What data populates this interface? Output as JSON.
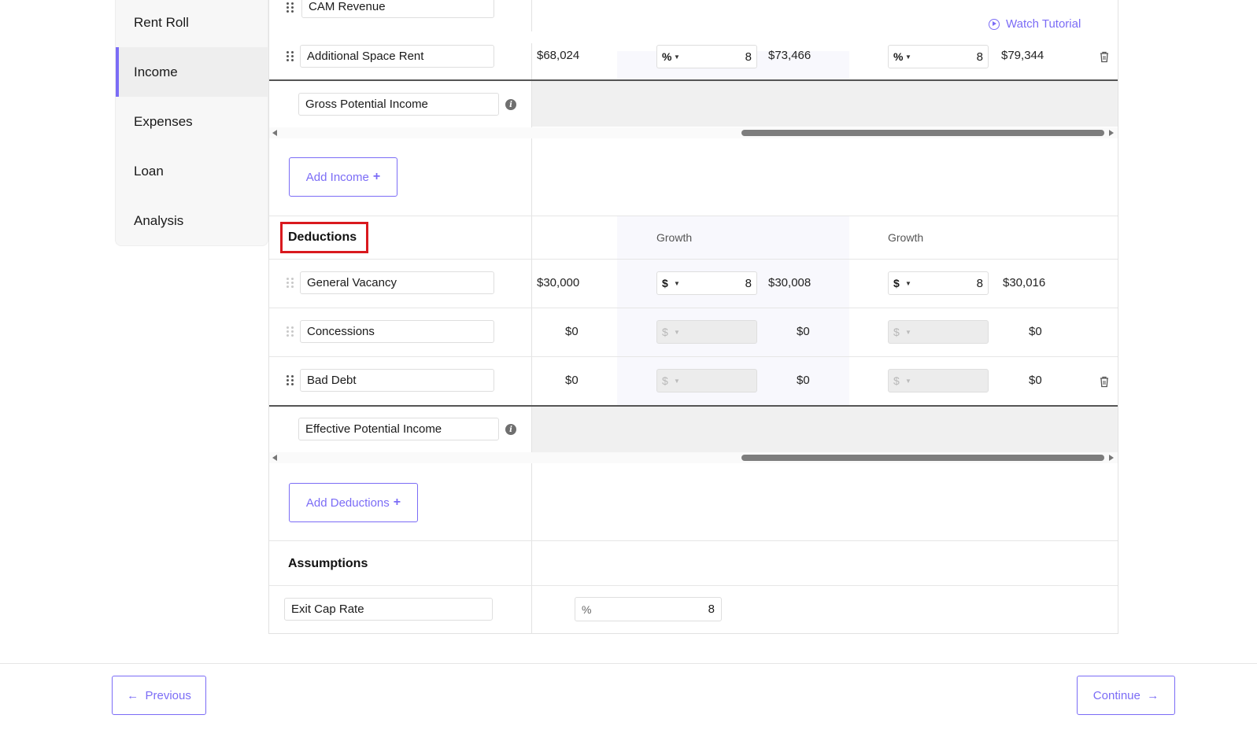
{
  "sidebar": {
    "items": [
      {
        "label": "Rent Roll",
        "active": false
      },
      {
        "label": "Income",
        "active": true
      },
      {
        "label": "Expenses",
        "active": false
      },
      {
        "label": "Loan",
        "active": false
      },
      {
        "label": "Analysis",
        "active": false
      }
    ]
  },
  "tutorial": {
    "label": "Watch Tutorial",
    "icon": "play-circle-icon"
  },
  "income": {
    "rows": [
      {
        "name": "CAM Revenue"
      },
      {
        "name": "Additional Space Rent",
        "base": "$68,024",
        "growth1": {
          "unit": "%",
          "value": "8"
        },
        "year2": "$73,466",
        "growth2": {
          "unit": "%",
          "value": "8"
        },
        "year3": "$79,344"
      }
    ],
    "total_label": "Gross Potential Income",
    "add_label": "Add Income"
  },
  "deductions": {
    "title": "Deductions",
    "growth_header_1": "Growth",
    "growth_header_2": "Growth",
    "rows": [
      {
        "name": "General Vacancy",
        "base": "$30,000",
        "growth1": {
          "unit": "$",
          "value": "8"
        },
        "year2": "$30,008",
        "growth2": {
          "unit": "$",
          "value": "8"
        },
        "year3": "$30,016"
      },
      {
        "name": "Concessions",
        "base": "$0",
        "growth1": {
          "unit": "$",
          "value": ""
        },
        "year2": "$0",
        "growth2": {
          "unit": "$",
          "value": ""
        },
        "year3": "$0"
      },
      {
        "name": "Bad Debt",
        "base": "$0",
        "growth1": {
          "unit": "$",
          "value": ""
        },
        "year2": "$0",
        "growth2": {
          "unit": "$",
          "value": ""
        },
        "year3": "$0"
      }
    ],
    "total_label": "Effective Potential Income",
    "add_label": "Add Deductions"
  },
  "assumptions": {
    "title": "Assumptions",
    "exit_cap": {
      "label": "Exit Cap Rate",
      "unit": "%",
      "value": "8"
    }
  },
  "footer": {
    "previous_label": "Previous",
    "continue_label": "Continue"
  },
  "colors": {
    "accent": "#7b6cf6",
    "highlight": "#d9191e"
  }
}
